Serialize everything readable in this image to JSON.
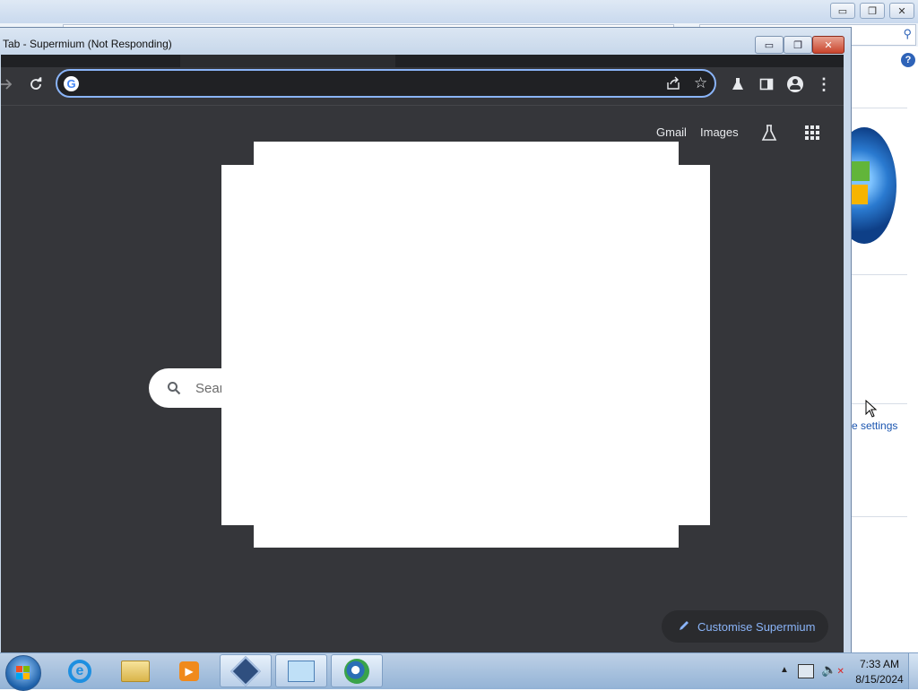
{
  "background_window": {
    "settings_link": "e settings",
    "help_label": "?"
  },
  "window": {
    "title": "Tab - Supermium (Not Responding)",
    "minimize": "▭",
    "restore": "❐",
    "close": "✕"
  },
  "ntp": {
    "gmail": "Gmail",
    "images": "Images",
    "search_placeholder": "Sear",
    "customise": "Customise Supermium"
  },
  "taskbar": {
    "time": "7:33 AM",
    "date": "8/15/2024"
  }
}
